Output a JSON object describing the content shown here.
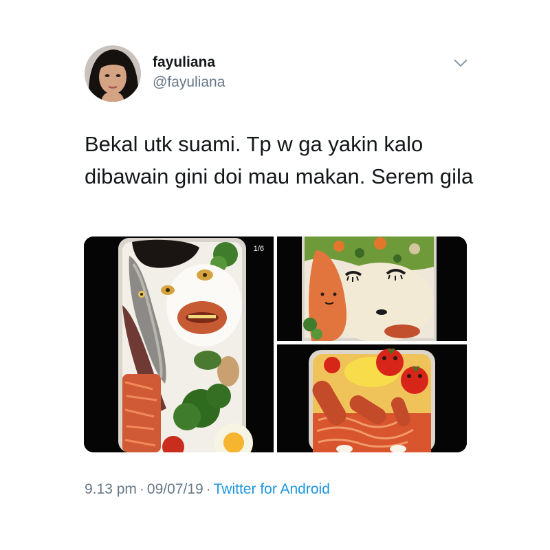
{
  "user": {
    "display_name": "fayuliana",
    "handle": "@fayuliana"
  },
  "tweet": {
    "text": "Bekal utk suami. Tp w ga yakin kalo dibawain gini doi mau makan. Serem gila",
    "media_counter": "1/6"
  },
  "meta": {
    "time": "9.13 pm",
    "separator": "·",
    "date": "09/07/19",
    "source": "Twitter for Android"
  },
  "colors": {
    "text": "#14171a",
    "secondary": "#657786",
    "link": "#1b95e0",
    "background": "#ffffff"
  },
  "icons": {
    "caret": "chevron-down-icon"
  }
}
